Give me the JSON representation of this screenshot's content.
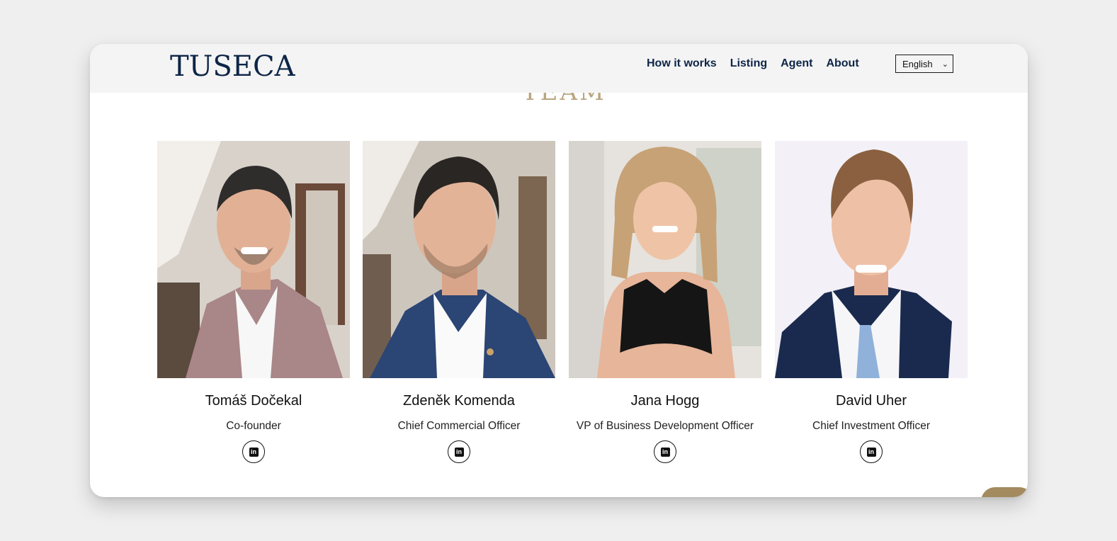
{
  "brand": {
    "logo": "TUSECA",
    "navy": "#0d2547",
    "gold": "#a38a5f"
  },
  "nav": {
    "items": [
      "How it works",
      "Listing",
      "Agent",
      "About"
    ]
  },
  "language": {
    "selected": "English",
    "icon": "chevron-down-icon"
  },
  "section": {
    "heading_fragment": "TEAM"
  },
  "team": [
    {
      "name": "Tomáš Dočekal",
      "role": "Co-founder",
      "icon": "linkedin-icon"
    },
    {
      "name": "Zdeněk Komenda",
      "role": "Chief Commercial Officer",
      "icon": "linkedin-icon"
    },
    {
      "name": "Jana Hogg",
      "role": "VP of Business Development Officer",
      "icon": "linkedin-icon"
    },
    {
      "name": "David Uher",
      "role": "Chief Investment Officer",
      "icon": "linkedin-icon"
    }
  ]
}
